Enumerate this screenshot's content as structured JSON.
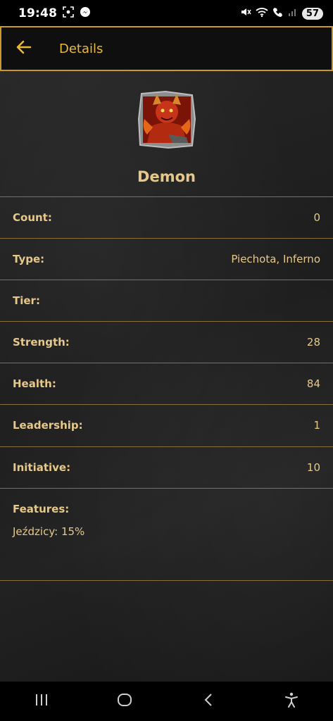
{
  "status_bar": {
    "time": "19:48",
    "battery": "57",
    "icons": [
      "screenshot-icon",
      "messenger-icon",
      "mute-icon",
      "wifi-icon",
      "wifi-calling-icon",
      "signal-icon"
    ]
  },
  "header": {
    "title": "Details"
  },
  "unit": {
    "name": "Demon",
    "portrait_icon": "demon-portrait"
  },
  "stats": [
    {
      "label": "Count:",
      "value": "0"
    },
    {
      "label": "Type:",
      "value": "Piechota, Inferno"
    },
    {
      "label": "Tier:",
      "value": ""
    },
    {
      "label": "Strength:",
      "value": "28"
    },
    {
      "label": "Health:",
      "value": "84"
    },
    {
      "label": "Leadership:",
      "value": "1"
    },
    {
      "label": "Initiative:",
      "value": "10"
    }
  ],
  "features": {
    "label": "Features:",
    "items": [
      "Jeździcy: 15%"
    ]
  },
  "colors": {
    "accent": "#c99a26",
    "text": "#e6c98a",
    "background": "#1f1f1f"
  }
}
